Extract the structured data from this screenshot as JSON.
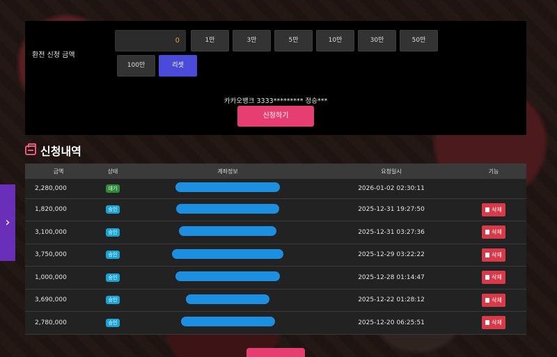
{
  "form": {
    "label": "환전 신청 금액",
    "amount_value": "0",
    "chips": [
      "1만",
      "3만",
      "5만",
      "10만",
      "30만",
      "50만",
      "100만"
    ],
    "reset_label": "리셋",
    "bank_info": "카카오뱅크 3333********* 정승***",
    "submit_label": "신청하기"
  },
  "history": {
    "title": "신청내역",
    "columns": [
      "금액",
      "상태",
      "계좌정보",
      "요청일시",
      "기능"
    ],
    "rows": [
      {
        "amount": "2,280,000",
        "status": "대기",
        "status_type": "wait",
        "datetime": "2026-01-02 02:30:11",
        "action": ""
      },
      {
        "amount": "1,820,000",
        "status": "승인",
        "status_type": "ok",
        "datetime": "2025-12-31 19:27:50",
        "action": "삭제"
      },
      {
        "amount": "3,100,000",
        "status": "승인",
        "status_type": "ok",
        "datetime": "2025-12-31 03:27:36",
        "action": "삭제"
      },
      {
        "amount": "3,750,000",
        "status": "승인",
        "status_type": "ok",
        "datetime": "2025-12-29 03:22:22",
        "action": "삭제"
      },
      {
        "amount": "1,000,000",
        "status": "승인",
        "status_type": "ok",
        "datetime": "2025-12-28 01:14:47",
        "action": "삭제"
      },
      {
        "amount": "3,690,000",
        "status": "승인",
        "status_type": "ok",
        "datetime": "2025-12-22 01:28:12",
        "action": "삭제"
      },
      {
        "amount": "2,780,000",
        "status": "승인",
        "status_type": "ok",
        "datetime": "2025-12-20 06:25:51",
        "action": "삭제"
      }
    ]
  },
  "side_tab": {
    "icon": "chevron-right-icon",
    "glyph": "›"
  },
  "colors": {
    "accent": "#e63e70",
    "reset": "#4a4bd8",
    "wait": "#2e8b3a",
    "ok": "#1aa3d6",
    "delete": "#d93a4a"
  }
}
